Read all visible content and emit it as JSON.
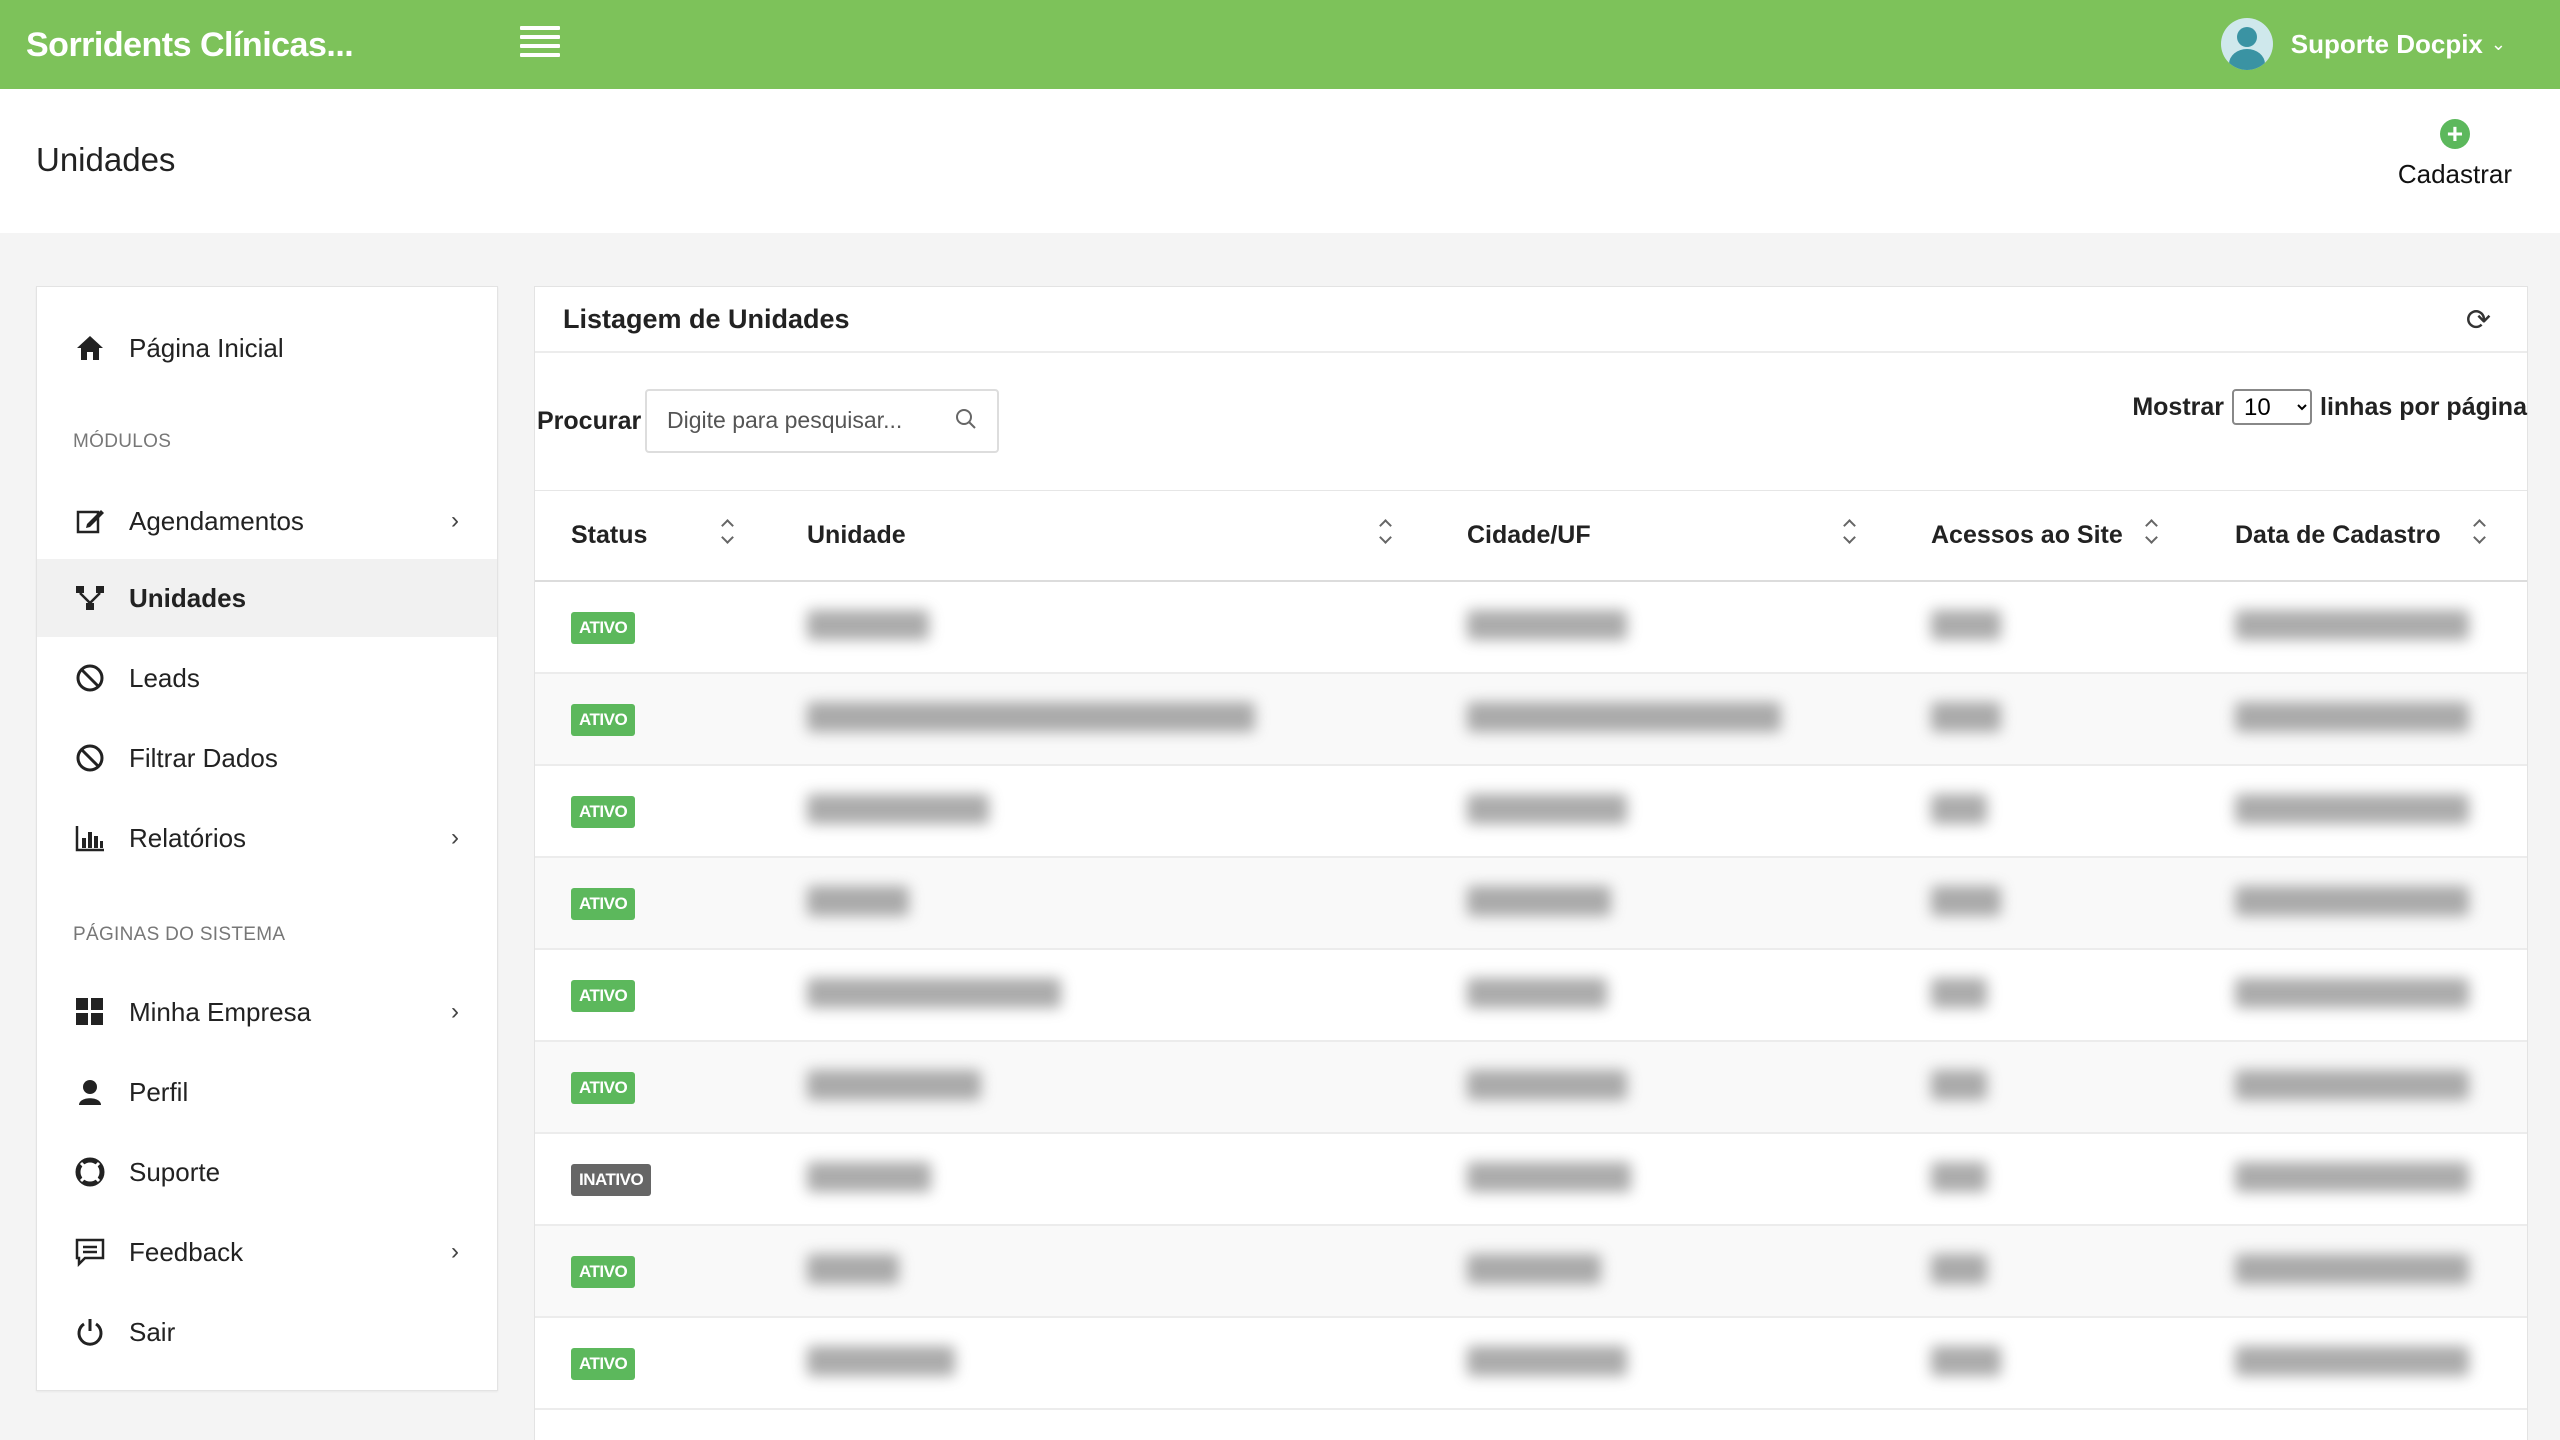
{
  "app": {
    "brand": "Sorridents Clínicas...",
    "user": "Suporte Docpix"
  },
  "page": {
    "title": "Unidades",
    "cadastrar": "Cadastrar"
  },
  "sidebar": {
    "home": "Página Inicial",
    "section_modules": "MÓDULOS",
    "agendamentos": "Agendamentos",
    "unidades": "Unidades",
    "leads": "Leads",
    "filtrar": "Filtrar Dados",
    "relatorios": "Relatórios",
    "section_system": "PÁGINAS DO SISTEMA",
    "empresa": "Minha Empresa",
    "perfil": "Perfil",
    "suporte": "Suporte",
    "feedback": "Feedback",
    "sair": "Sair"
  },
  "panel": {
    "title": "Listagem de Unidades",
    "search_label": "Procurar",
    "search_placeholder": "Digite para pesquisar...",
    "show_label": "Mostrar",
    "show_value": "10",
    "show_suffix": "linhas por página"
  },
  "table": {
    "columns": [
      "Status",
      "Unidade",
      "Cidade/UF",
      "Acessos ao Site",
      "Data de Cadastro"
    ],
    "rows": [
      {
        "status": "ATIVO"
      },
      {
        "status": "ATIVO"
      },
      {
        "status": "ATIVO"
      },
      {
        "status": "ATIVO"
      },
      {
        "status": "ATIVO"
      },
      {
        "status": "ATIVO"
      },
      {
        "status": "INATIVO"
      },
      {
        "status": "ATIVO"
      },
      {
        "status": "ATIVO"
      }
    ]
  },
  "colors": {
    "accent": "#7dc25a",
    "active_badge": "#5cb85c",
    "inactive_badge": "#666666"
  },
  "icons": {
    "home": "home-icon",
    "agendamentos": "edit-icon",
    "unidades": "sitemap-icon",
    "leads": "ban-icon",
    "filtrar": "ban-icon",
    "relatorios": "bar-chart-icon",
    "empresa": "grid-icon",
    "perfil": "user-icon",
    "suporte": "lifebuoy-icon",
    "feedback": "comment-icon",
    "sair": "power-icon"
  }
}
